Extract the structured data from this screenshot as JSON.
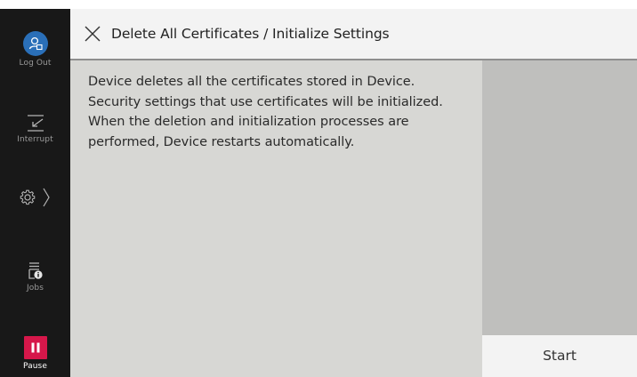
{
  "sidebar": {
    "logout_label": "Log Out",
    "interrupt_label": "Interrupt",
    "jobs_label": "Jobs",
    "pause_label": "Pause",
    "icons": [
      "user-logout-icon",
      "interrupt-icon",
      "gear-icon",
      "chevron-right-icon",
      "jobs-icon",
      "pause-icon"
    ]
  },
  "header": {
    "title": "Delete All Certificates / Initialize Settings",
    "close_icon": "close-icon"
  },
  "main": {
    "message_lines": [
      "Device deletes all the certificates stored in Device.",
      "Security settings that use certificates will be initialized.",
      "When the deletion and initialization processes are",
      "performed, Device restarts automatically."
    ]
  },
  "actions": {
    "start_label": "Start"
  },
  "colors": {
    "sidebar_bg": "#181818",
    "logout_accent": "#2a6fb8",
    "pause_accent": "#d6174a",
    "content_bg": "#d7d7d4",
    "right_panel_bg": "#bfbfbd",
    "titlebar_bg": "#f3f3f3"
  }
}
